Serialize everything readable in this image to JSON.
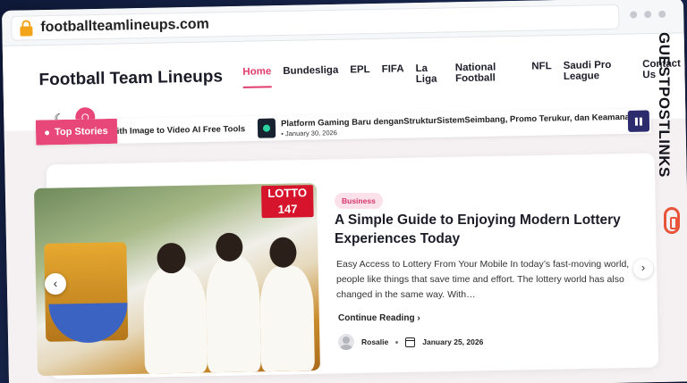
{
  "browser": {
    "url": "footballteamlineups.com"
  },
  "header": {
    "site_title": "Football Team Lineups",
    "nav": [
      {
        "label": "Home",
        "active": true
      },
      {
        "label": "Bundesliga"
      },
      {
        "label": "EPL"
      },
      {
        "label": "FIFA"
      },
      {
        "label": "La Liga"
      },
      {
        "label": "National Football"
      },
      {
        "label": "NFL"
      },
      {
        "label": "Saudi Pro League"
      },
      {
        "label": "Contact Us"
      }
    ],
    "mode_toggle_icon": "moon-icon",
    "search_icon": "search-icon"
  },
  "ticker": {
    "label": "Top Stories",
    "items": [
      {
        "title": "ith Image to Video AI Free Tools"
      },
      {
        "title": "Platform Gaming Baru denganStrukturSistemSeimbang, Promo Terukur, dan Keamanan Kons",
        "date": "January 30, 2026"
      }
    ]
  },
  "feature": {
    "image_banner_line1": "LOTTO",
    "image_banner_line2": "147",
    "category": "Business",
    "title": "A Simple Guide to Enjoying Modern Lottery Experiences Today",
    "excerpt": "Easy Access to Lottery From Your Mobile In today’s fast-moving world, people like things that save time and effort. The lottery world has also changed in the same way. With…",
    "read_more": "Continue Reading",
    "author": "Rosalie",
    "date": "January 25, 2026"
  },
  "watermark": {
    "text": "GUESTPOSTLINKS"
  },
  "colors": {
    "accent": "#e8477a",
    "dark_button": "#2b2b6e",
    "badge_bg": "#fde1ea"
  }
}
